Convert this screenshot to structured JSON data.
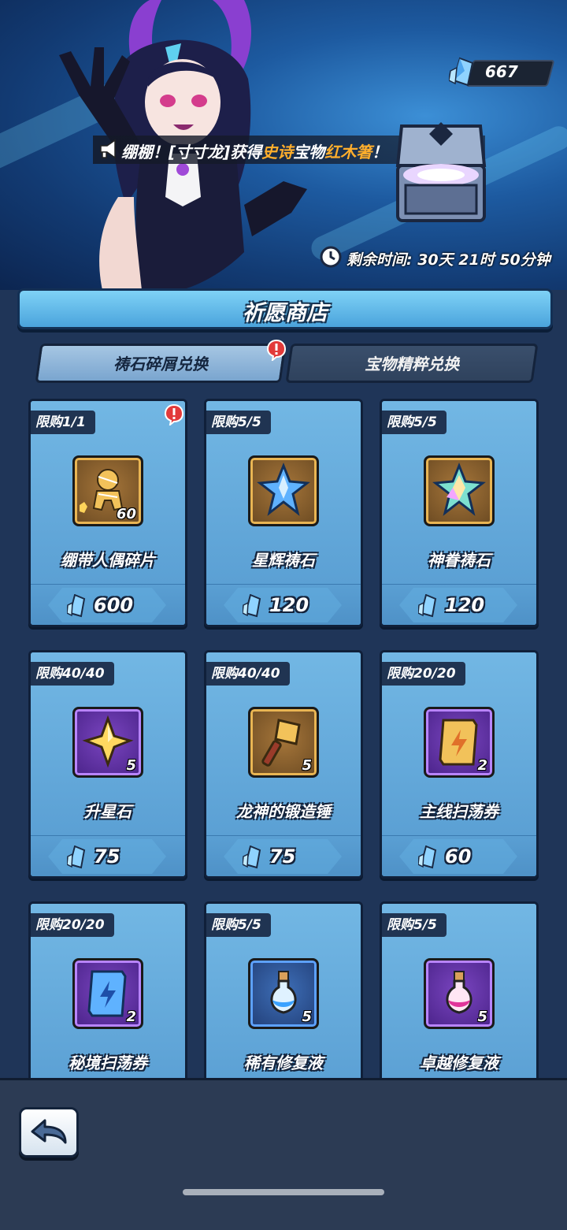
{
  "banner": {
    "currency_amount": "667",
    "broadcast": {
      "prefix": "绷棚！[寸寸龙]获得",
      "rarity": "史诗",
      "middle": "宝物",
      "item": "红木箸",
      "suffix": "！"
    },
    "timer_label": "剩余时间: 30天 21时 50分钟"
  },
  "shop": {
    "title": "祈愿商店",
    "tabs": [
      {
        "label": "祷石碎屑兑换",
        "active": true
      },
      {
        "label": "宝物精粹兑换",
        "active": false
      }
    ],
    "items": [
      {
        "limit": "限购1/1",
        "name": "绷带人偶碎片",
        "qty": "60",
        "price": "600",
        "icon": "bandage-doll-fragment-icon",
        "frame": "gold",
        "alert": true
      },
      {
        "limit": "限购5/5",
        "name": "星辉祷石",
        "qty": "",
        "price": "120",
        "icon": "blue-crystal-icon",
        "frame": "gold",
        "alert": false
      },
      {
        "limit": "限购5/5",
        "name": "神眷祷石",
        "qty": "",
        "price": "120",
        "icon": "rainbow-crystal-icon",
        "frame": "gold",
        "alert": false
      },
      {
        "limit": "限购40/40",
        "name": "升星石",
        "qty": "5",
        "price": "75",
        "icon": "star-stone-icon",
        "frame": "purple",
        "alert": false
      },
      {
        "limit": "限购40/40",
        "name": "龙神的锻造锤",
        "qty": "5",
        "price": "75",
        "icon": "forging-hammer-icon",
        "frame": "gold",
        "alert": false
      },
      {
        "limit": "限购20/20",
        "name": "主线扫荡券",
        "qty": "2",
        "price": "60",
        "icon": "gold-sweep-ticket-icon",
        "frame": "purple",
        "alert": false
      },
      {
        "limit": "限购20/20",
        "name": "秘境扫荡券",
        "qty": "2",
        "price": "",
        "icon": "blue-sweep-ticket-icon",
        "frame": "purple",
        "alert": false
      },
      {
        "limit": "限购5/5",
        "name": "稀有修复液",
        "qty": "5",
        "price": "",
        "icon": "blue-potion-icon",
        "frame": "blue",
        "alert": false
      },
      {
        "limit": "限购5/5",
        "name": "卓越修复液",
        "qty": "5",
        "price": "",
        "icon": "pink-potion-icon",
        "frame": "purple",
        "alert": false
      }
    ]
  },
  "colors": {
    "accent_orange": "#ffae2c",
    "card_blue": "#5fa2d6",
    "background": "#1f3558"
  }
}
